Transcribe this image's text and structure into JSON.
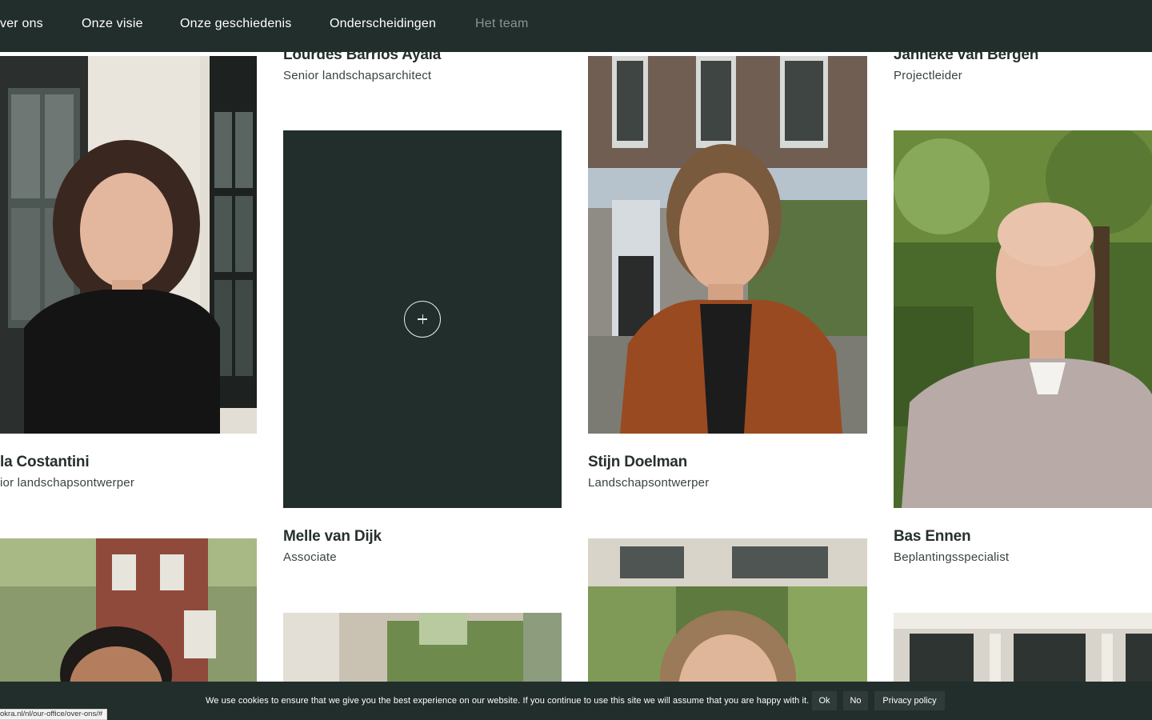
{
  "nav": {
    "items": [
      {
        "label": "ver ons",
        "active": false
      },
      {
        "label": "Onze visie",
        "active": false
      },
      {
        "label": "Onze geschiedenis",
        "active": false
      },
      {
        "label": "Onderscheidingen",
        "active": false
      },
      {
        "label": "Het team",
        "active": true
      }
    ]
  },
  "team": {
    "lourdes": {
      "name": "Lourdes Barrios Ayala",
      "role": "Senior landschapsarchitect"
    },
    "janneke": {
      "name": "Janneke van Bergen",
      "role": "Projectleider"
    },
    "costantini": {
      "name": "la Costantini",
      "role": "ior landschapsontwerper"
    },
    "stijn": {
      "name": "Stijn Doelman",
      "role": "Landschapsontwerper"
    },
    "melle": {
      "name": "Melle van Dijk",
      "role": "Associate"
    },
    "bas": {
      "name": "Bas Ennen",
      "role": "Beplantingsspecialist"
    }
  },
  "cookie": {
    "text": "We use cookies to ensure that we give you the best experience on our website. If you continue to use this site we will assume that you are happy with it.",
    "ok_label": "Ok",
    "no_label": "No",
    "privacy_label": "Privacy policy"
  },
  "status_url": "okra.nl/nl/our-office/over-ons/#",
  "colors": {
    "nav_bg": "#212e2b",
    "accent_dark": "#212e2b",
    "active_nav": "#8a9591"
  }
}
